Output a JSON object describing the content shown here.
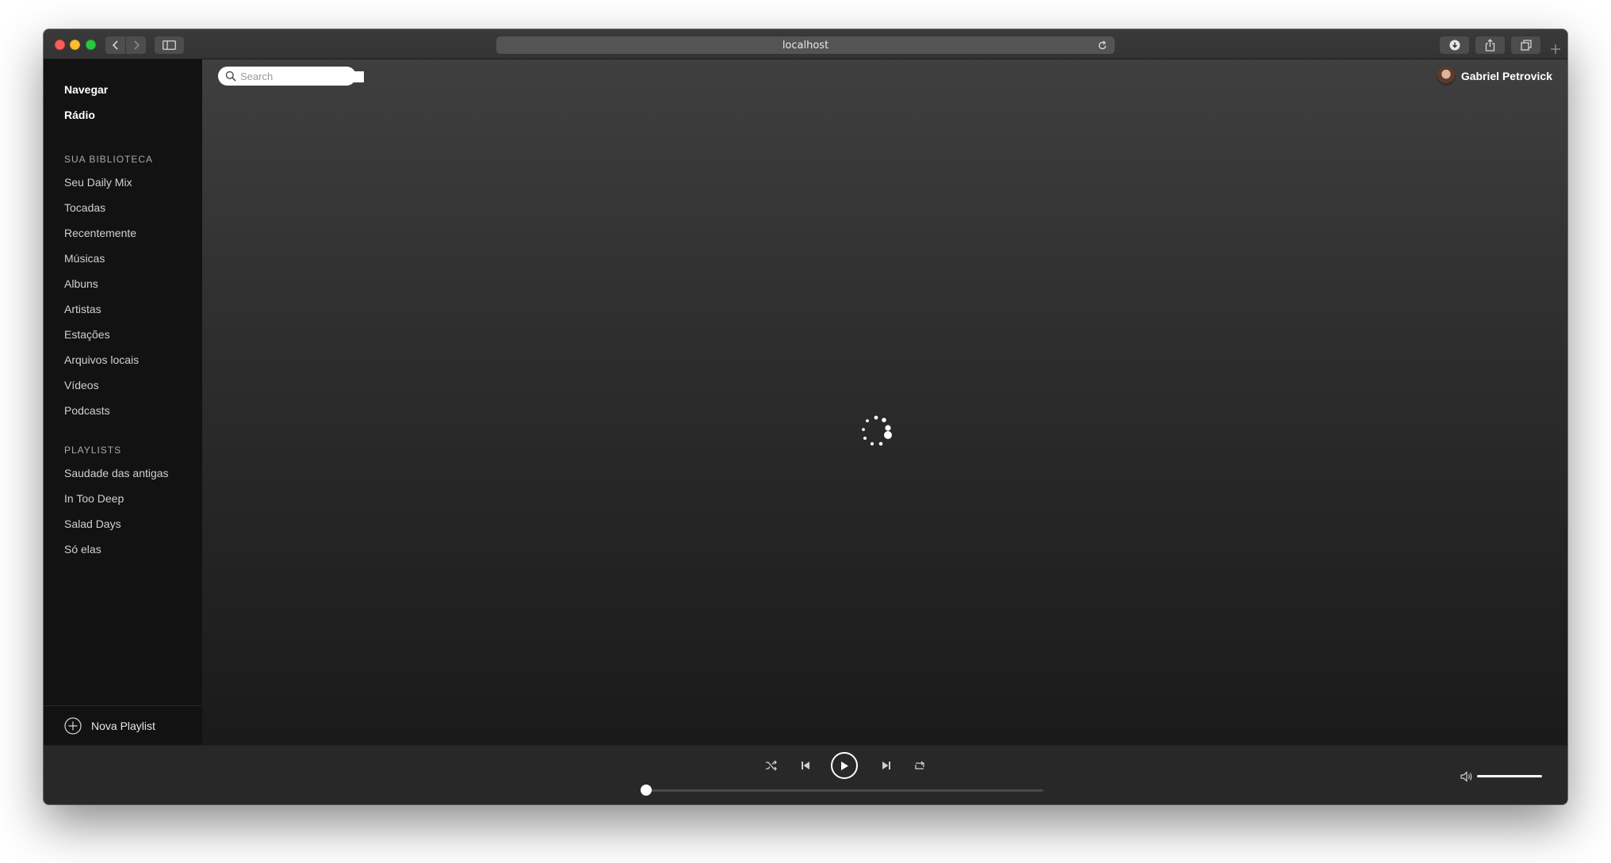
{
  "browser": {
    "url": "localhost"
  },
  "sidebar": {
    "nav": [
      {
        "label": "Navegar"
      },
      {
        "label": "Rádio"
      }
    ],
    "library_title": "SUA BIBLIOTECA",
    "library_items": [
      {
        "label": "Seu Daily Mix"
      },
      {
        "label": "Tocadas"
      },
      {
        "label": "Recentemente"
      },
      {
        "label": "Músicas"
      },
      {
        "label": "Albuns"
      },
      {
        "label": "Artistas"
      },
      {
        "label": "Estações"
      },
      {
        "label": "Arquivos locais"
      },
      {
        "label": "Vídeos"
      },
      {
        "label": "Podcasts"
      }
    ],
    "playlists_title": "PLAYLISTS",
    "playlists": [
      {
        "label": "Saudade das antigas"
      },
      {
        "label": "In Too Deep"
      },
      {
        "label": "Salad Days"
      },
      {
        "label": "Só elas"
      }
    ],
    "new_playlist_label": "Nova Playlist"
  },
  "header": {
    "search_placeholder": "Search",
    "search_value": "",
    "user_name": "Gabriel Petrovick"
  },
  "player": {
    "progress_fraction": 0,
    "volume_fraction": 1,
    "is_playing": false
  },
  "icons": {
    "back": "chevron-left-icon",
    "forward": "chevron-right-icon",
    "sidebar": "sidebar-icon",
    "reload": "reload-icon",
    "download": "download-icon",
    "share": "share-icon",
    "tabs": "tabs-icon",
    "new_tab": "plus-icon",
    "search": "search-icon",
    "loading": "loading-spinner-icon",
    "shuffle": "shuffle-icon",
    "previous": "skip-previous-icon",
    "play": "play-icon",
    "next": "skip-next-icon",
    "repeat": "repeat-icon",
    "volume": "volume-icon",
    "new_playlist": "plus-circle-icon"
  },
  "colors": {
    "sidebar_bg": "#121212",
    "player_bg": "#282828",
    "text_primary": "#ffffff",
    "text_secondary": "#a8a8a8"
  }
}
